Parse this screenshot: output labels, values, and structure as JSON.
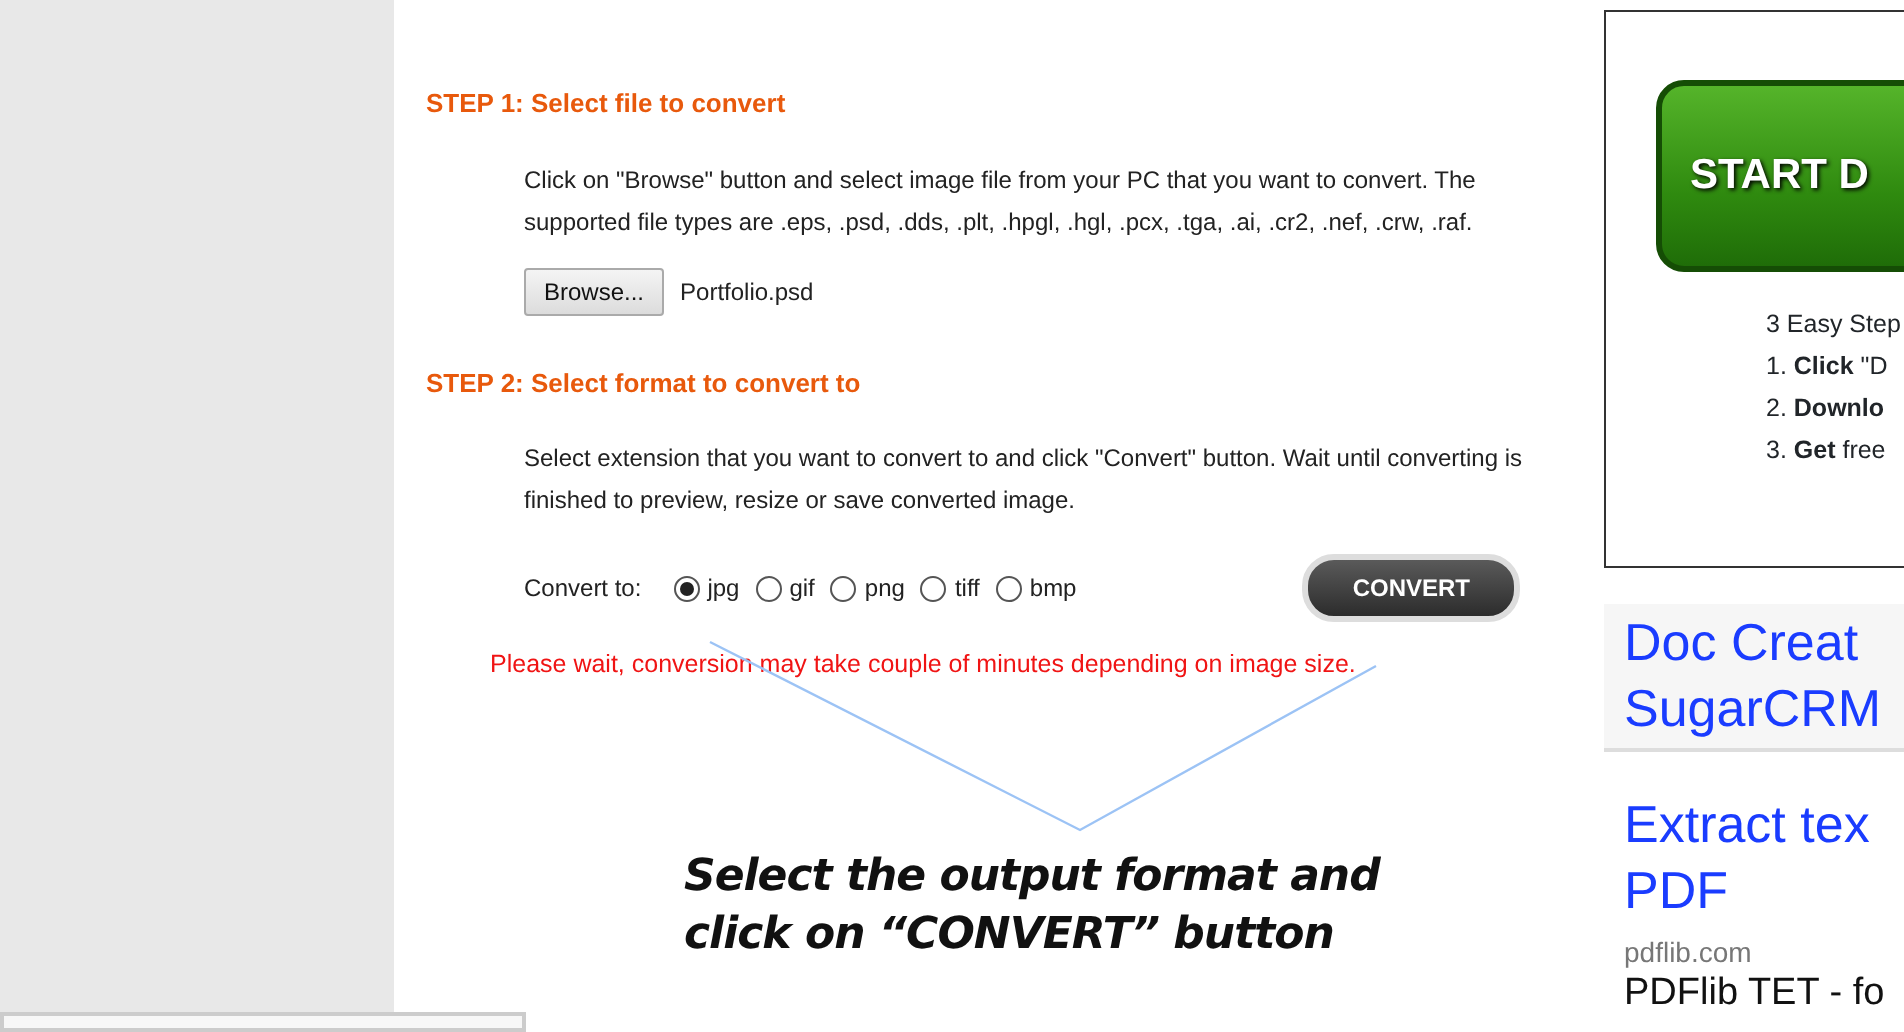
{
  "step1": {
    "title": "STEP 1: Select file to convert",
    "text": "Click on \"Browse\" button and select image file from your PC that you want to convert. The supported file types are .eps, .psd, .dds, .plt, .hpgl, .hgl, .pcx, .tga, .ai, .cr2, .nef, .crw, .raf.",
    "browse_button": "Browse...",
    "file_name": "Portfolio.psd"
  },
  "step2": {
    "title": "STEP 2: Select format to convert to",
    "text": "Select extension that you want to convert to and click \"Convert\" button. Wait until converting is finished to preview, resize or save converted image.",
    "label": "Convert to:",
    "formats": [
      {
        "label": "jpg",
        "selected": true
      },
      {
        "label": "gif",
        "selected": false
      },
      {
        "label": "png",
        "selected": false
      },
      {
        "label": "tiff",
        "selected": false
      },
      {
        "label": "bmp",
        "selected": false
      }
    ],
    "convert_button": "CONVERT",
    "notice": "Please wait, conversion may take couple of minutes depending on image size."
  },
  "annotation": {
    "lines": [
      "Select the output format and",
      "click on “CONVERT” button"
    ]
  },
  "ad": {
    "button": "START D",
    "lines": [
      "3 Easy Step",
      "1. **Click** \"D",
      "2. **Downlo**",
      "3. **Get** free"
    ]
  },
  "links": [
    {
      "title_lines": [
        "Doc Creat",
        "SugarCRM"
      ]
    },
    {
      "title_lines": [
        "Extract tex",
        "PDF"
      ],
      "source": "pdflib.com",
      "snippet": "PDFlib TET - fo"
    }
  ]
}
